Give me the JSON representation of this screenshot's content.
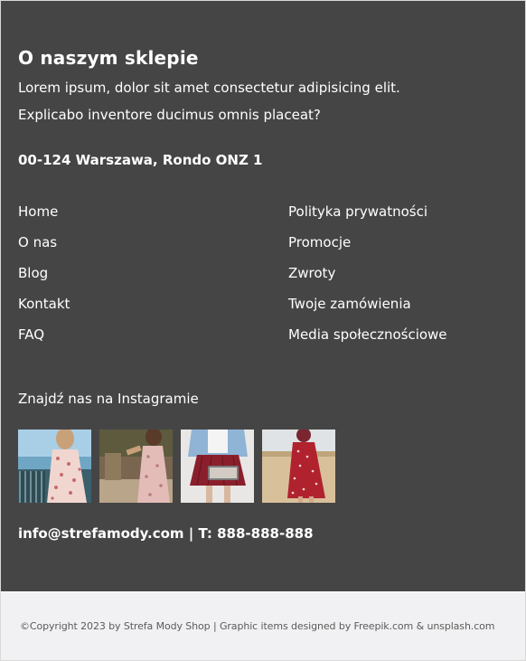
{
  "about": {
    "title": "O naszym sklepie",
    "line1": "Lorem ipsum, dolor sit amet consectetur adipisicing elit.",
    "line2": "Explicabo inventore ducimus omnis placeat?",
    "address": "00-124 Warszawa, Rondo ONZ 1"
  },
  "nav": {
    "left": [
      {
        "label": "Home"
      },
      {
        "label": "O nas"
      },
      {
        "label": "Blog"
      },
      {
        "label": "Kontakt"
      },
      {
        "label": "FAQ"
      }
    ],
    "right": [
      {
        "label": "Polityka prywatności"
      },
      {
        "label": "Promocje"
      },
      {
        "label": "Zwroty"
      },
      {
        "label": "Twoje zamówienia"
      },
      {
        "label": "Media społecznościowe"
      }
    ]
  },
  "instagram": {
    "heading": "Znajdź nas na Instagramie",
    "photos": [
      {
        "name": "woman-floral-dress-seaside-photo"
      },
      {
        "name": "woman-pink-dress-walking-photo"
      },
      {
        "name": "woman-red-skirt-denim-jacket-photo"
      },
      {
        "name": "woman-red-polka-dress-field-photo"
      }
    ]
  },
  "contact": {
    "text": "info@strefamody.com | T: 888-888-888"
  },
  "copyright": {
    "prefix": "©Copyright 2023 by Strefa Mody Shop | Graphic items designed by ",
    "link1": "Freepik.com",
    "middle": " & ",
    "link2": "unsplash.com"
  },
  "colors": {
    "footer_bg": "#464546",
    "bottom_bg": "#f1f1f3",
    "text": "#ffffff"
  }
}
